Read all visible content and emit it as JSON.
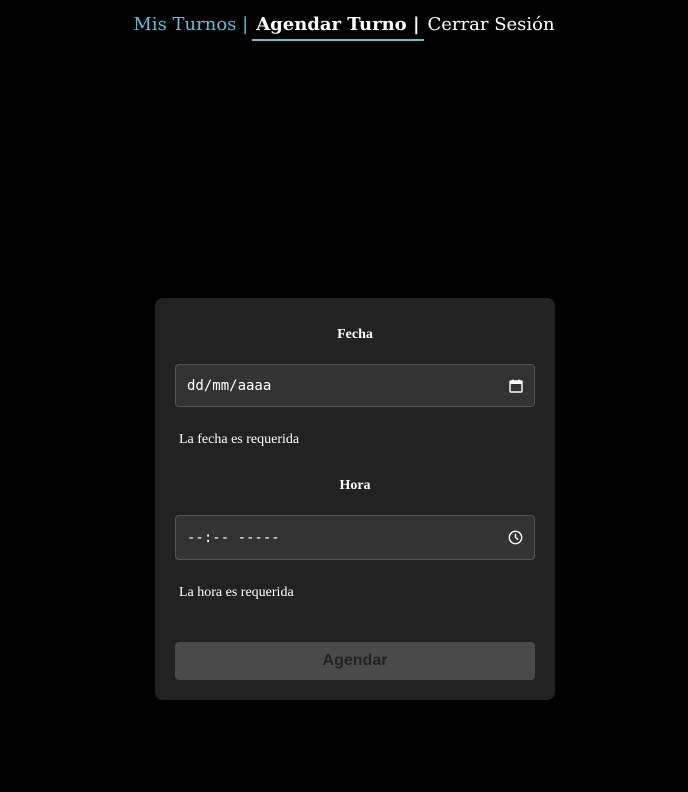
{
  "nav": {
    "mis_turnos": "Mis Turnos |",
    "agendar_turno": "Agendar Turno |",
    "cerrar_sesion": "Cerrar Sesión"
  },
  "form": {
    "fecha_label": "Fecha",
    "fecha_value": "dd/mm/aaaa",
    "fecha_error": "La fecha es requerida",
    "hora_label": "Hora",
    "hora_value": "--:-- -----",
    "hora_error": "La hora es requerida",
    "submit_label": "Agendar"
  },
  "icons": {
    "fecha": "calendar-icon",
    "hora": "clock-icon"
  },
  "colors": {
    "accent": "#5bc0de",
    "background": "#000000",
    "card": "#222222"
  }
}
